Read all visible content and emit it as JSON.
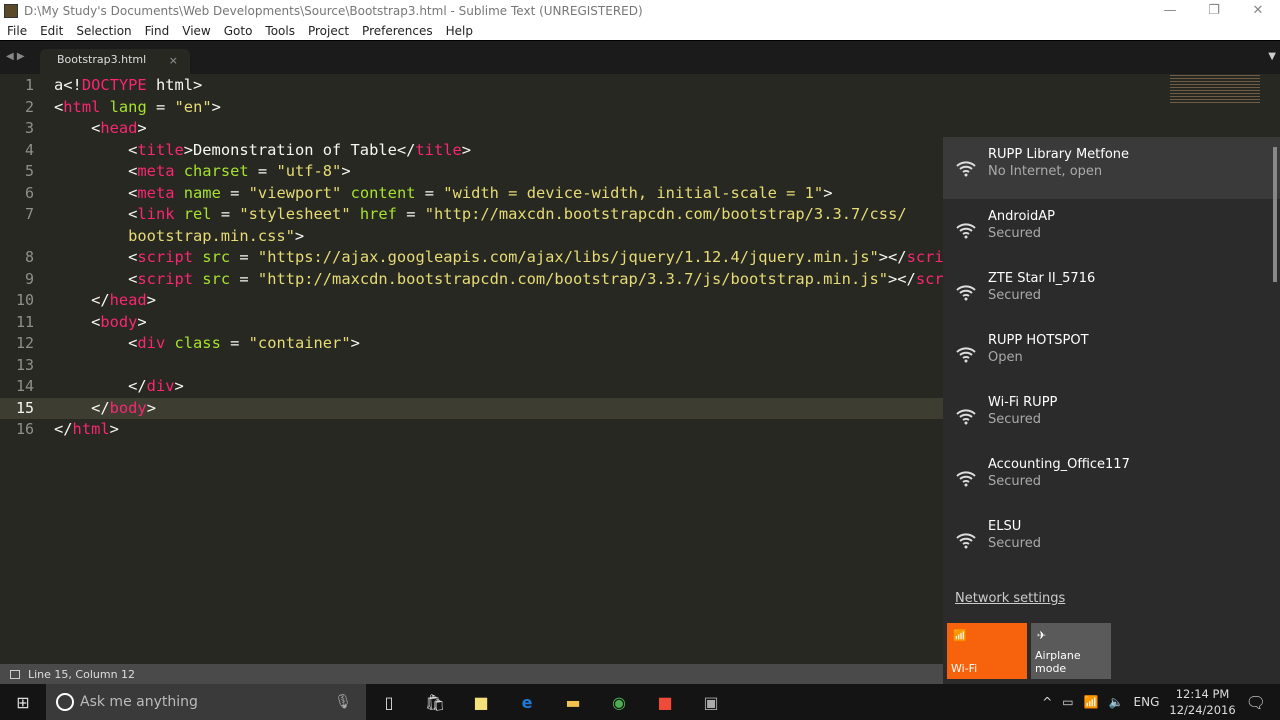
{
  "window": {
    "title": "D:\\My Study's Documents\\Web Developments\\Source\\Bootstrap3.html - Sublime Text (UNREGISTERED)",
    "min": "—",
    "max": "❐",
    "close": "✕"
  },
  "menu": [
    "File",
    "Edit",
    "Selection",
    "Find",
    "View",
    "Goto",
    "Tools",
    "Project",
    "Preferences",
    "Help"
  ],
  "tab": {
    "label": "Bootstrap3.html",
    "close": "×"
  },
  "editor": {
    "current_line": 15,
    "lines": [
      {
        "n": "1",
        "tokens": [
          [
            "txt",
            "a<!"
          ],
          [
            "tag",
            "DOCTYPE"
          ],
          [
            "txt",
            " html>"
          ]
        ]
      },
      {
        "n": "2",
        "tokens": [
          [
            "txt",
            "<"
          ],
          [
            "tag",
            "html"
          ],
          [
            "txt",
            " "
          ],
          [
            "attr",
            "lang"
          ],
          [
            "txt",
            " = "
          ],
          [
            "str",
            "\"en\""
          ],
          [
            "txt",
            ">"
          ]
        ]
      },
      {
        "n": "3",
        "tokens": [
          [
            "txt",
            "    <"
          ],
          [
            "tag",
            "head"
          ],
          [
            "txt",
            ">"
          ]
        ]
      },
      {
        "n": "4",
        "tokens": [
          [
            "txt",
            "        <"
          ],
          [
            "tag",
            "title"
          ],
          [
            "txt",
            ">Demonstration of Table</"
          ],
          [
            "tag",
            "title"
          ],
          [
            "txt",
            ">"
          ]
        ]
      },
      {
        "n": "5",
        "tokens": [
          [
            "txt",
            "        <"
          ],
          [
            "tag",
            "meta"
          ],
          [
            "txt",
            " "
          ],
          [
            "attr",
            "charset"
          ],
          [
            "txt",
            " = "
          ],
          [
            "str",
            "\"utf-8\""
          ],
          [
            "txt",
            ">"
          ]
        ]
      },
      {
        "n": "6",
        "tokens": [
          [
            "txt",
            "        <"
          ],
          [
            "tag",
            "meta"
          ],
          [
            "txt",
            " "
          ],
          [
            "attr",
            "name"
          ],
          [
            "txt",
            " = "
          ],
          [
            "str",
            "\"viewport\""
          ],
          [
            "txt",
            " "
          ],
          [
            "attr",
            "content"
          ],
          [
            "txt",
            " = "
          ],
          [
            "str",
            "\"width = device-width, initial-scale = 1\""
          ],
          [
            "txt",
            ">"
          ]
        ]
      },
      {
        "n": "7",
        "tokens": [
          [
            "txt",
            "        <"
          ],
          [
            "tag",
            "link"
          ],
          [
            "txt",
            " "
          ],
          [
            "attr",
            "rel"
          ],
          [
            "txt",
            " = "
          ],
          [
            "str",
            "\"stylesheet\""
          ],
          [
            "txt",
            " "
          ],
          [
            "attr",
            "href"
          ],
          [
            "txt",
            " = "
          ],
          [
            "str",
            "\"http://maxcdn.bootstrapcdn.com/bootstrap/3.3.7/css/"
          ]
        ]
      },
      {
        "n": "",
        "tokens": [
          [
            "str",
            "        bootstrap.min.css\""
          ],
          [
            "txt",
            ">"
          ]
        ]
      },
      {
        "n": "8",
        "tokens": [
          [
            "txt",
            "        <"
          ],
          [
            "tag",
            "script"
          ],
          [
            "txt",
            " "
          ],
          [
            "attr",
            "src"
          ],
          [
            "txt",
            " = "
          ],
          [
            "str",
            "\"https://ajax.googleapis.com/ajax/libs/jquery/1.12.4/jquery.min.js\""
          ],
          [
            "txt",
            "></"
          ],
          [
            "tag",
            "script"
          ],
          [
            "txt",
            ">"
          ]
        ]
      },
      {
        "n": "9",
        "tokens": [
          [
            "txt",
            "        <"
          ],
          [
            "tag",
            "script"
          ],
          [
            "txt",
            " "
          ],
          [
            "attr",
            "src"
          ],
          [
            "txt",
            " = "
          ],
          [
            "str",
            "\"http://maxcdn.bootstrapcdn.com/bootstrap/3.3.7/js/bootstrap.min.js\""
          ],
          [
            "txt",
            "></"
          ],
          [
            "tag",
            "script"
          ],
          [
            "txt",
            ">"
          ]
        ]
      },
      {
        "n": "10",
        "tokens": [
          [
            "txt",
            "    </"
          ],
          [
            "tag",
            "head"
          ],
          [
            "txt",
            ">"
          ]
        ]
      },
      {
        "n": "11",
        "tokens": [
          [
            "txt",
            "    <"
          ],
          [
            "tag",
            "body"
          ],
          [
            "txt",
            ">"
          ]
        ]
      },
      {
        "n": "12",
        "tokens": [
          [
            "txt",
            "        <"
          ],
          [
            "tag",
            "div"
          ],
          [
            "txt",
            " "
          ],
          [
            "attr",
            "class"
          ],
          [
            "txt",
            " = "
          ],
          [
            "str",
            "\"container\""
          ],
          [
            "txt",
            ">"
          ]
        ]
      },
      {
        "n": "13",
        "tokens": [
          [
            "txt",
            ""
          ]
        ]
      },
      {
        "n": "14",
        "tokens": [
          [
            "txt",
            "        </"
          ],
          [
            "tag",
            "div"
          ],
          [
            "txt",
            ">"
          ]
        ]
      },
      {
        "n": "15",
        "tokens": [
          [
            "txt",
            "    </"
          ],
          [
            "tag",
            "body"
          ],
          [
            "txt",
            ">"
          ]
        ]
      },
      {
        "n": "16",
        "tokens": [
          [
            "txt",
            "</"
          ],
          [
            "tag",
            "html"
          ],
          [
            "txt",
            ">"
          ]
        ]
      }
    ]
  },
  "statusbar": {
    "position": "Line 15, Column 12"
  },
  "network": {
    "items": [
      {
        "name": "RUPP Library Metfone",
        "status": "No Internet, open",
        "shield": true
      },
      {
        "name": "AndroidAP",
        "status": "Secured",
        "shield": false
      },
      {
        "name": "ZTE Star II_5716",
        "status": "Secured",
        "shield": false
      },
      {
        "name": "RUPP HOTSPOT",
        "status": "Open",
        "shield": true
      },
      {
        "name": "Wi-Fi RUPP",
        "status": "Secured",
        "shield": false
      },
      {
        "name": "Accounting_Office117",
        "status": "Secured",
        "shield": false
      },
      {
        "name": "ELSU",
        "status": "Secured",
        "shield": false
      }
    ],
    "settings": "Network settings",
    "wifi_tile": "Wi-Fi",
    "airplane_tile": "Airplane mode",
    "accent": "#f7630c"
  },
  "taskbar": {
    "search_placeholder": "Ask me anything",
    "lang": "ENG",
    "time": "12:14 PM",
    "date": "12/24/2016"
  }
}
